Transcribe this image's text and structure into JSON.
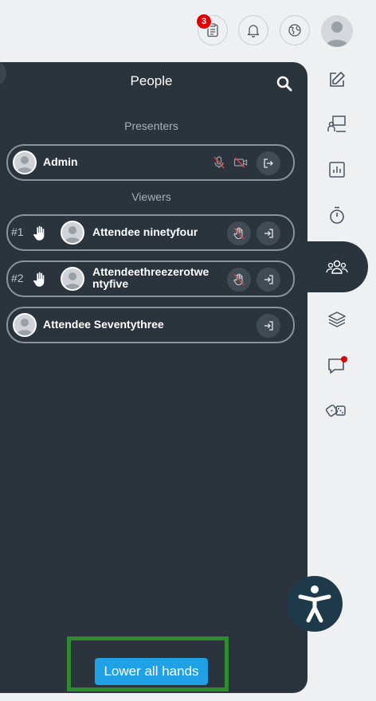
{
  "topbar": {
    "notes_badge": "3",
    "icons": [
      "clipboard-icon",
      "bell-icon",
      "globe-icon",
      "user-avatar"
    ]
  },
  "panel": {
    "title": "People",
    "presenters_label": "Presenters",
    "viewers_label": "Viewers",
    "presenters": [
      {
        "name": "Admin"
      }
    ],
    "viewers": [
      {
        "rank": "#1",
        "name": "Attendee ninetyfour",
        "hand_raised": true
      },
      {
        "rank": "#2",
        "name": "Attendeethreezerotwe\nntyfive",
        "hand_raised": true
      },
      {
        "rank": "",
        "name": "Attendee Seventythree",
        "hand_raised": false
      }
    ],
    "lower_all_hands_label": "Lower all hands"
  },
  "sidebar": {
    "items": [
      "edit-icon",
      "presenter-screen-icon",
      "poll-chart-icon",
      "timer-icon",
      "people-icon",
      "layers-icon",
      "chat-icon",
      "dice-icon"
    ],
    "active": "people-icon",
    "chat_unread_color": "#e00000"
  },
  "colors": {
    "panel_bg": "#2b333c",
    "accent": "#1ea1e6",
    "highlight_box": "#2e8b2e"
  }
}
